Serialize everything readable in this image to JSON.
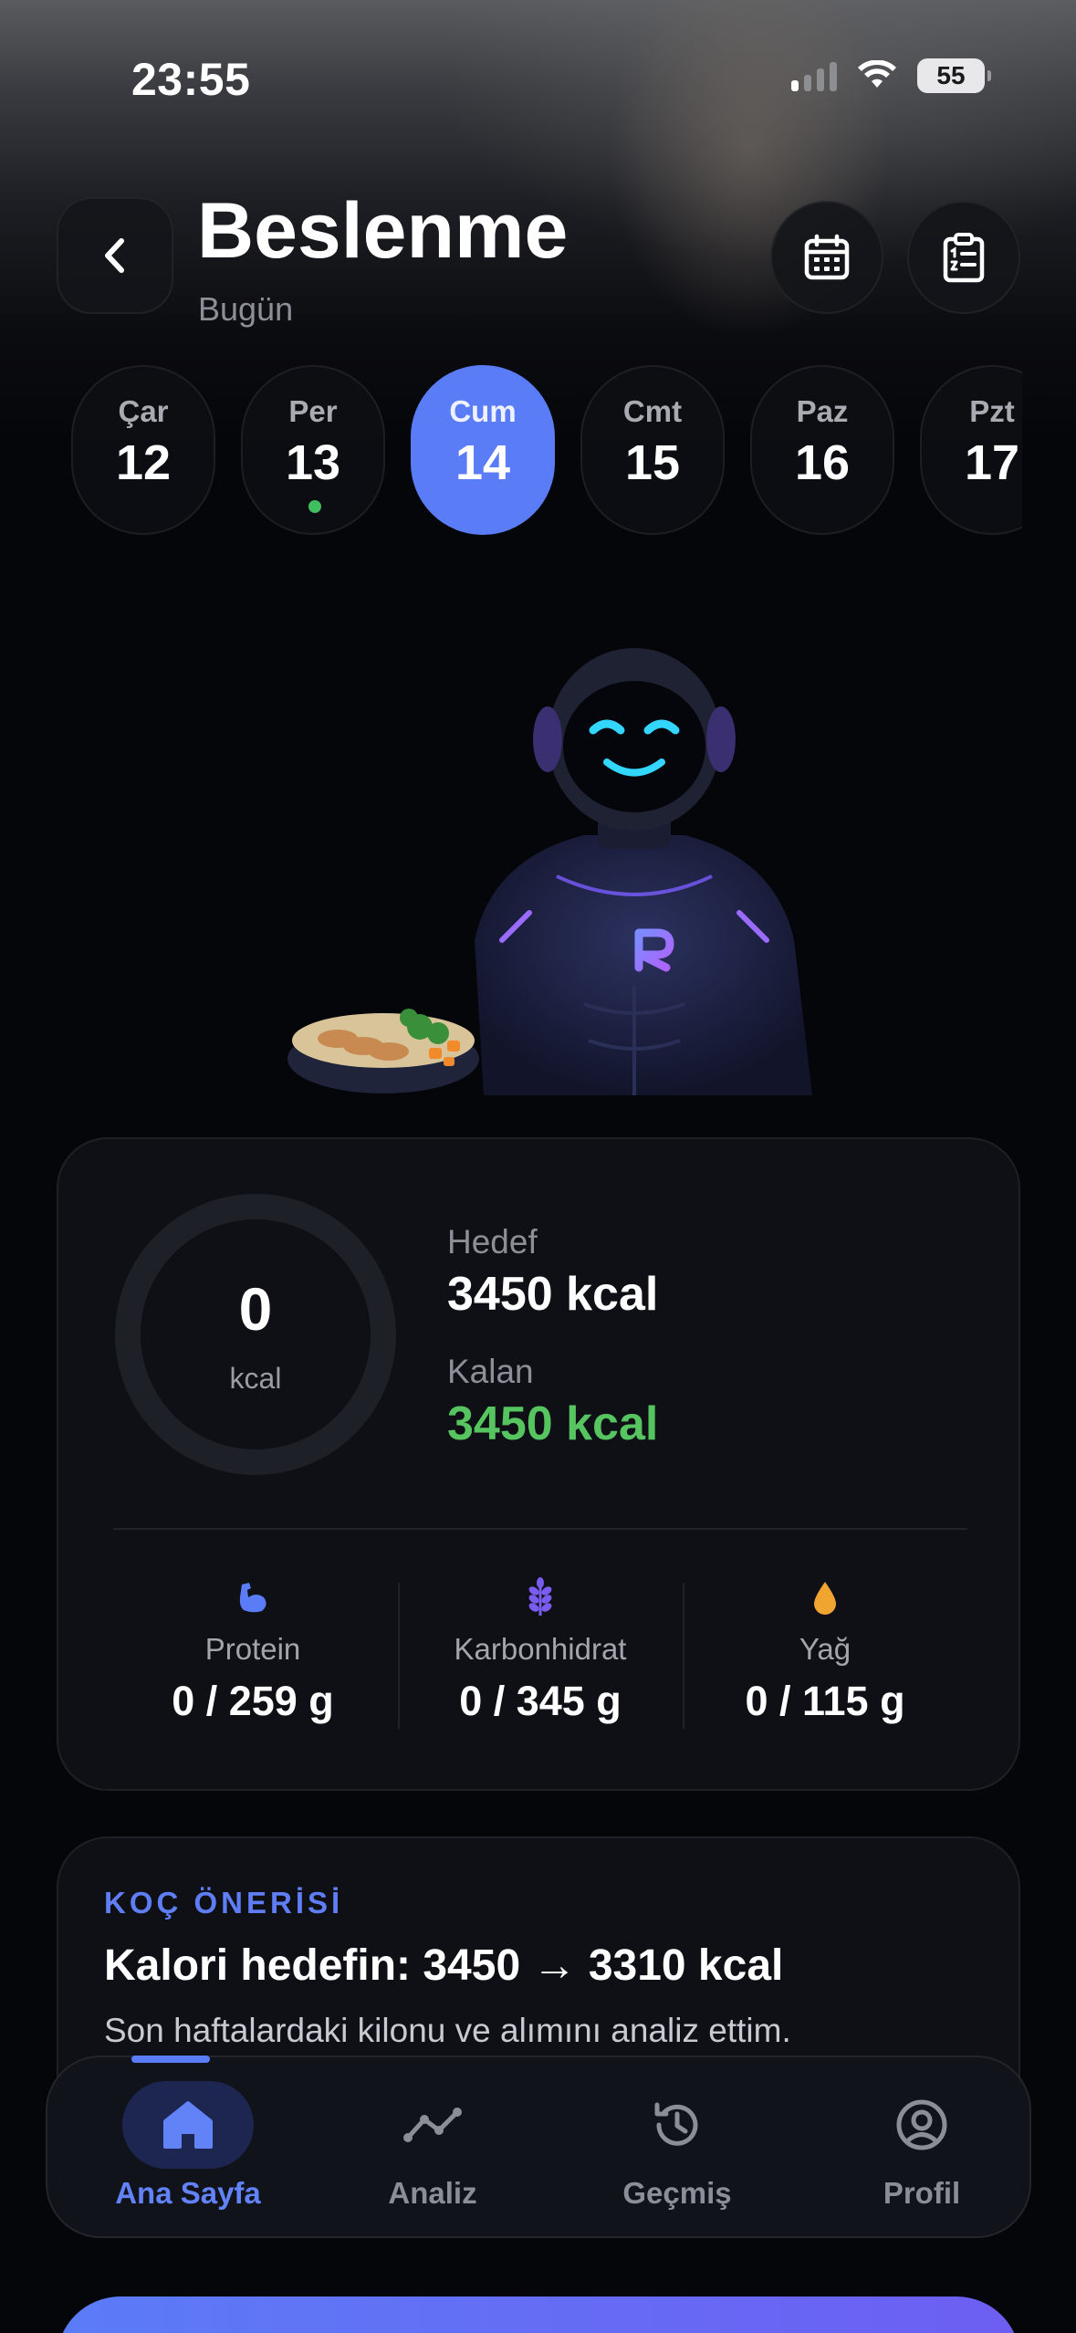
{
  "status_bar": {
    "time": "23:55",
    "battery": "55"
  },
  "header": {
    "title": "Beslenme",
    "subtitle": "Bugün"
  },
  "days": [
    {
      "name": "Çar",
      "num": "12",
      "active": false,
      "has_dot": false
    },
    {
      "name": "Per",
      "num": "13",
      "active": false,
      "has_dot": true
    },
    {
      "name": "Cum",
      "num": "14",
      "active": true,
      "has_dot": false
    },
    {
      "name": "Cmt",
      "num": "15",
      "active": false,
      "has_dot": false
    },
    {
      "name": "Paz",
      "num": "16",
      "active": false,
      "has_dot": false
    },
    {
      "name": "Pzt",
      "num": "17",
      "active": false,
      "has_dot": false
    }
  ],
  "calories": {
    "consumed": "0",
    "unit": "kcal",
    "goal_label": "Hedef",
    "goal_value": "3450 kcal",
    "remaining_label": "Kalan",
    "remaining_value": "3450 kcal",
    "progress": 0
  },
  "macros": {
    "protein": {
      "label": "Protein",
      "value": "0 / 259 g",
      "color": "#5b7cf7"
    },
    "carbs": {
      "label": "Karbonhidrat",
      "value": "0 / 345 g",
      "color": "#7a5cf0"
    },
    "fat": {
      "label": "Yağ",
      "value": "0 / 115 g",
      "color": "#f0a531"
    }
  },
  "coach": {
    "tag": "KOÇ ÖNERİSİ",
    "title": "Kalori hedefin: 3450 → 3310 kcal",
    "body": "Son haftalardaki kilonu ve alımını analiz ettim."
  },
  "tabs": [
    {
      "label": "Ana Sayfa",
      "icon": "home-icon",
      "active": true
    },
    {
      "label": "Analiz",
      "icon": "chart-line-icon",
      "active": false
    },
    {
      "label": "Geçmiş",
      "icon": "history-icon",
      "active": false
    },
    {
      "label": "Profil",
      "icon": "profile-icon",
      "active": false
    }
  ],
  "colors": {
    "accent": "#5b7cf7",
    "success": "#56c45f",
    "background": "#05060a"
  }
}
